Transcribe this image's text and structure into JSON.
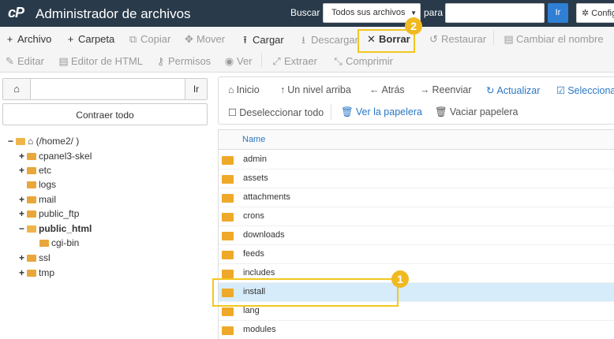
{
  "header": {
    "logo": "cP",
    "title": "Administrador de archivos",
    "search_label": "Buscar",
    "search_scope": "Todos sus archivos",
    "for_label": "para",
    "search_input_value": "",
    "go_label": "Ir",
    "config_label": "Configuración"
  },
  "toolbar": {
    "row1": [
      {
        "label": "Archivo",
        "icon": "+",
        "enabled": true
      },
      {
        "label": "Carpeta",
        "icon": "+",
        "enabled": true
      },
      {
        "label": "Copiar",
        "icon": "⧉",
        "enabled": false
      },
      {
        "label": "Mover",
        "icon": "✥",
        "enabled": false
      },
      {
        "label": "Cargar",
        "icon": "⭱",
        "enabled": true
      },
      {
        "label": "Descargar",
        "icon": "⭳",
        "enabled": false
      },
      {
        "label": "Borrar",
        "icon": "✕",
        "enabled": true
      },
      {
        "label": "Restaurar",
        "icon": "↺",
        "enabled": false
      },
      {
        "label": "Cambiar el nombre",
        "icon": "▤",
        "enabled": false
      }
    ],
    "row2": [
      {
        "label": "Editar",
        "icon": "✎",
        "enabled": false
      },
      {
        "label": "Editor de HTML",
        "icon": "▤",
        "enabled": false
      },
      {
        "label": "Permisos",
        "icon": "⚷",
        "enabled": false
      },
      {
        "label": "Ver",
        "icon": "◉",
        "enabled": false
      },
      {
        "label": "Extraer",
        "icon": "⤢",
        "enabled": false
      },
      {
        "label": "Comprimir",
        "icon": "⤡",
        "enabled": false
      }
    ]
  },
  "annotations": {
    "badge1": "1",
    "badge2": "2"
  },
  "left": {
    "path_input_value": "",
    "go_label": "Ir",
    "collapse_label": "Contraer todo",
    "tree": [
      {
        "label": "(/home2/ )",
        "toggle": "−",
        "icon": "home",
        "level": 0,
        "bold": false
      },
      {
        "label": "cpanel3-skel",
        "toggle": "+",
        "level": 1,
        "bold": false
      },
      {
        "label": "etc",
        "toggle": "+",
        "level": 1,
        "bold": false
      },
      {
        "label": "logs",
        "toggle": "",
        "level": 1,
        "bold": false
      },
      {
        "label": "mail",
        "toggle": "+",
        "level": 1,
        "bold": false
      },
      {
        "label": "public_ftp",
        "toggle": "+",
        "level": 1,
        "bold": false
      },
      {
        "label": "public_html",
        "toggle": "−",
        "level": 1,
        "bold": true
      },
      {
        "label": "cgi-bin",
        "toggle": "",
        "level": 2,
        "bold": false
      },
      {
        "label": "ssl",
        "toggle": "+",
        "level": 1,
        "bold": false
      },
      {
        "label": "tmp",
        "toggle": "+",
        "level": 1,
        "bold": false
      }
    ]
  },
  "nav": {
    "home": "Inicio",
    "up": "Un nivel arriba",
    "back": "Atrás",
    "forward": "Reenviar",
    "refresh": "Actualizar",
    "select_all": "Seleccionar todo",
    "deselect_all": "Deseleccionar todo",
    "view_trash": "Ver la papelera",
    "empty_trash": "Vaciar papelera"
  },
  "table": {
    "header_name": "Name",
    "rows": [
      "admin",
      "assets",
      "attachments",
      "crons",
      "downloads",
      "feeds",
      "includes",
      "install",
      "lang",
      "modules"
    ],
    "selected": "install"
  },
  "colors": {
    "topbar": "#293a4a",
    "accent_blue": "#2b77c4",
    "highlight": "#f2c71f",
    "folder": "#efa929",
    "selected_row": "#d6ecfa"
  }
}
